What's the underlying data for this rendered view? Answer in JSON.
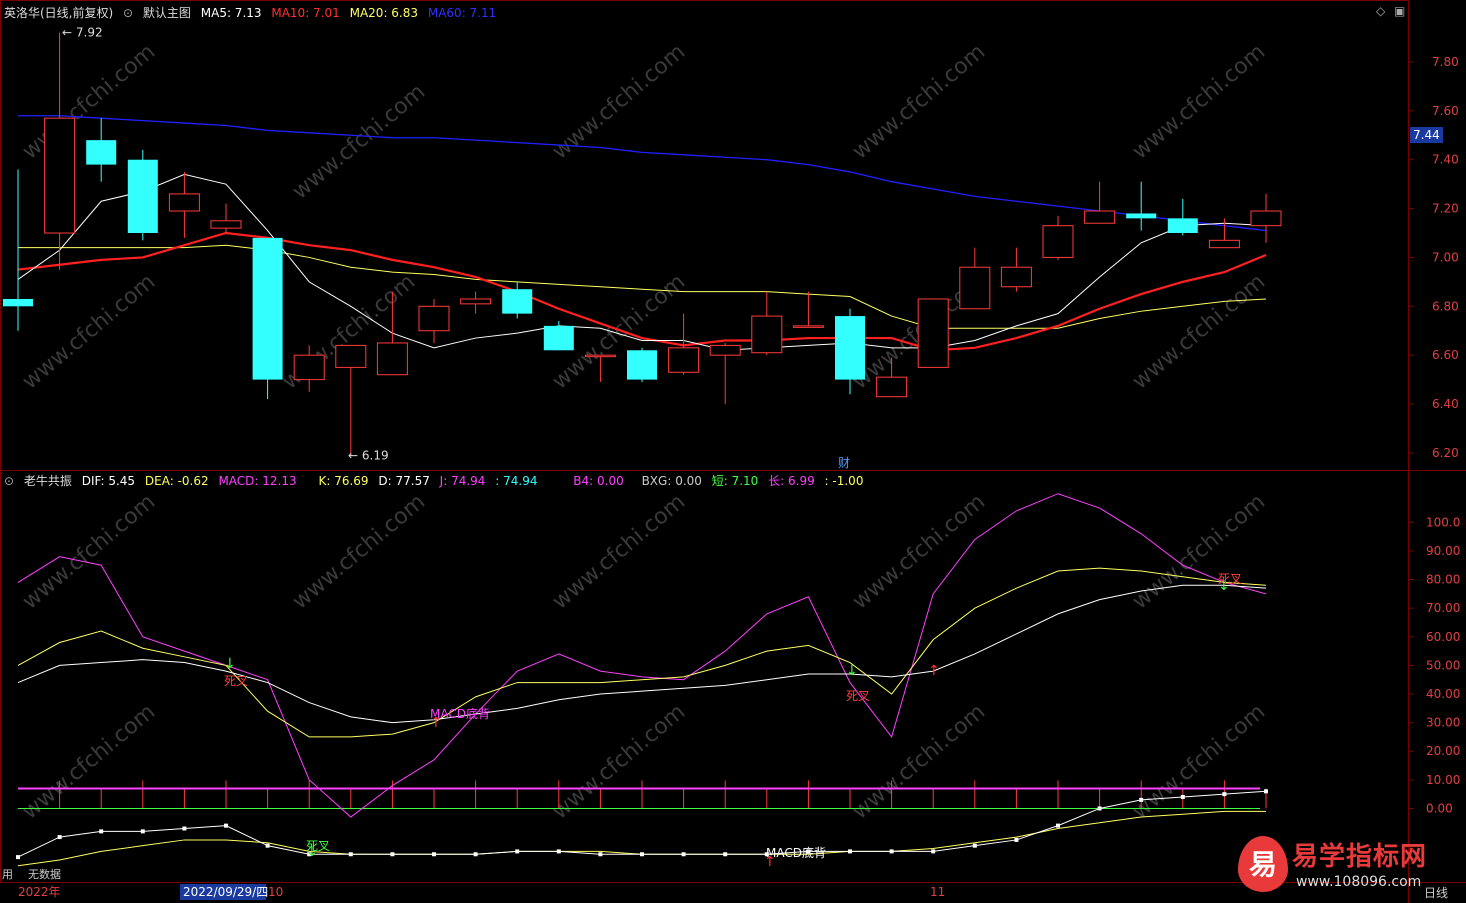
{
  "main_header": {
    "stock": "英洛华(日线,前复权)",
    "template": "默认主图",
    "ma5": "MA5: 7.13",
    "ma10": "MA10: 7.01",
    "ma20": "MA20: 6.83",
    "ma60": "MA60: 7.11"
  },
  "sub_header": {
    "name": "老牛共振",
    "dif": "DIF: 5.45",
    "dea": "DEA: -0.62",
    "macd": "MACD: 12.13",
    "k": "K: 76.69",
    "d": "D: 77.57",
    "j": "J: 74.94",
    "j2": ": 74.94",
    "b4": "B4: 0.00",
    "bxg": "BXG: 0.00",
    "short": "短: 7.10",
    "long": "长: 6.99",
    "extra": ": -1.00"
  },
  "price_tag": "7.44",
  "hi_label": "7.92",
  "lo_label": "6.19",
  "cai": "财",
  "main_axis": [
    "7.80",
    "7.60",
    "7.40",
    "7.20",
    "7.00",
    "6.80",
    "6.60",
    "6.40",
    "6.20"
  ],
  "sub_axis": [
    "100.0",
    "90.00",
    "80.00",
    "70.00",
    "60.00",
    "50.00",
    "40.00",
    "30.00",
    "20.00",
    "10.00",
    "0.00"
  ],
  "signals": [
    "死叉",
    "MACD底背",
    "死叉",
    "死叉",
    "死叉",
    "MACD底背"
  ],
  "bottom": {
    "left_text": "用",
    "left_text2": "无数据",
    "year": "2022年",
    "cursor_date": "2022/09/29/四",
    "m10": "10",
    "m11": "11",
    "period": "日线"
  },
  "watermark": "www.cfchi.com",
  "logo": {
    "mark": "易",
    "name": "易学指标网",
    "url": "www.108096.com"
  },
  "colors": {
    "up": "#ff3b3b",
    "down": "#3ff",
    "ma5": "#fff",
    "ma10": "#ff2020",
    "ma20": "#ffff60",
    "ma60": "#2020ff",
    "grid": "#7a0000"
  },
  "chart_data": {
    "type": "candlestick",
    "ylim": [
      6.13,
      7.98
    ],
    "candles": [
      [
        6.83,
        6.7,
        6.8,
        7.36
      ],
      [
        7.1,
        6.95,
        7.57,
        7.92
      ],
      [
        7.48,
        7.31,
        7.38,
        7.57
      ],
      [
        7.4,
        7.07,
        7.1,
        7.44
      ],
      [
        7.19,
        7.08,
        7.26,
        7.35
      ],
      [
        7.12,
        7.1,
        7.15,
        7.22
      ],
      [
        7.08,
        6.42,
        6.5,
        7.08
      ],
      [
        6.5,
        6.45,
        6.6,
        6.64
      ],
      [
        6.55,
        6.19,
        6.64,
        6.64
      ],
      [
        6.52,
        6.52,
        6.65,
        6.86
      ],
      [
        6.7,
        6.65,
        6.8,
        6.83
      ],
      [
        6.81,
        6.77,
        6.83,
        6.86
      ],
      [
        6.87,
        6.75,
        6.77,
        6.9
      ],
      [
        6.72,
        6.62,
        6.62,
        6.74
      ],
      [
        6.6,
        6.49,
        6.6,
        6.6
      ],
      [
        6.62,
        6.49,
        6.5,
        6.63
      ],
      [
        6.53,
        6.52,
        6.63,
        6.77
      ],
      [
        6.6,
        6.4,
        6.64,
        6.65
      ],
      [
        6.61,
        6.6,
        6.76,
        6.86
      ],
      [
        6.72,
        6.72,
        6.72,
        6.86
      ],
      [
        6.76,
        6.44,
        6.5,
        6.79
      ],
      [
        6.43,
        6.43,
        6.51,
        6.59
      ],
      [
        6.55,
        6.55,
        6.83,
        6.83
      ],
      [
        6.79,
        6.79,
        6.96,
        7.04
      ],
      [
        6.88,
        6.86,
        6.96,
        7.04
      ],
      [
        7.0,
        6.99,
        7.13,
        7.17
      ],
      [
        7.14,
        7.14,
        7.19,
        7.31
      ],
      [
        7.18,
        7.11,
        7.16,
        7.31
      ],
      [
        7.16,
        7.09,
        7.1,
        7.24
      ],
      [
        7.04,
        7.04,
        7.07,
        7.16
      ],
      [
        7.13,
        7.06,
        7.19,
        7.26
      ]
    ],
    "ma5": [
      6.91,
      7.03,
      7.23,
      7.27,
      7.34,
      7.3,
      7.11,
      6.9,
      6.8,
      6.69,
      6.63,
      6.67,
      6.69,
      6.72,
      6.71,
      6.66,
      6.66,
      6.62,
      6.63,
      6.64,
      6.65,
      6.63,
      6.63,
      6.66,
      6.72,
      6.77,
      6.92,
      7.06,
      7.13,
      7.14,
      7.13
    ],
    "ma10": [
      6.95,
      6.97,
      6.99,
      7.0,
      7.05,
      7.1,
      7.08,
      7.05,
      7.03,
      6.99,
      6.96,
      6.92,
      6.86,
      6.79,
      6.73,
      6.67,
      6.64,
      6.66,
      6.66,
      6.67,
      6.67,
      6.67,
      6.62,
      6.63,
      6.67,
      6.72,
      6.79,
      6.85,
      6.9,
      6.94,
      7.01
    ],
    "ma20": [
      7.04,
      7.04,
      7.04,
      7.04,
      7.04,
      7.05,
      7.03,
      7.0,
      6.96,
      6.94,
      6.93,
      6.91,
      6.9,
      6.89,
      6.88,
      6.87,
      6.86,
      6.86,
      6.86,
      6.85,
      6.84,
      6.76,
      6.71,
      6.71,
      6.71,
      6.71,
      6.75,
      6.78,
      6.8,
      6.82,
      6.83
    ],
    "ma60": [
      7.58,
      7.58,
      7.57,
      7.56,
      7.55,
      7.54,
      7.52,
      7.51,
      7.5,
      7.49,
      7.49,
      7.48,
      7.47,
      7.46,
      7.45,
      7.43,
      7.42,
      7.41,
      7.4,
      7.38,
      7.35,
      7.31,
      7.28,
      7.25,
      7.23,
      7.21,
      7.19,
      7.17,
      7.15,
      7.13,
      7.11
    ],
    "sub_ylim": [
      -25,
      112
    ],
    "K": [
      44,
      50,
      51,
      52,
      51,
      48,
      44,
      37,
      32,
      30,
      31,
      33,
      35,
      38,
      40,
      41,
      42,
      43,
      45,
      47,
      47,
      46,
      48,
      54,
      61,
      68,
      73,
      76,
      78,
      78,
      77
    ],
    "D": [
      50,
      58,
      62,
      56,
      53,
      50,
      34,
      25,
      25,
      26,
      30,
      39,
      44,
      44,
      44,
      45,
      46,
      50,
      55,
      57,
      51,
      40,
      59,
      70,
      77,
      83,
      84,
      83,
      81,
      79,
      78
    ],
    "J": [
      79,
      88,
      85,
      60,
      55,
      50,
      45,
      10,
      -3,
      8,
      17,
      33,
      48,
      54,
      48,
      46,
      45,
      55,
      68,
      74,
      44,
      25,
      75,
      94,
      104,
      110,
      105,
      96,
      85,
      79,
      75
    ],
    "ml_upper": 7,
    "ml_lower": 0,
    "white_line": [
      -17,
      -10,
      -8,
      -8,
      -7,
      -6,
      -13,
      -16,
      -16,
      -16,
      -16,
      -16,
      -15,
      -15,
      -16,
      -16,
      -16,
      -16,
      -16,
      -15,
      -15,
      -15,
      -15,
      -13,
      -11,
      -6,
      0,
      3,
      4,
      5,
      6
    ],
    "yellow_line": [
      -20,
      -18,
      -15,
      -13,
      -11,
      -11,
      -12,
      -15,
      -16,
      -16,
      -16,
      -16,
      -15,
      -15,
      -15,
      -16,
      -16,
      -16,
      -16,
      -16,
      -15,
      -15,
      -14,
      -12,
      -10,
      -7,
      -5,
      -3,
      -2,
      -1,
      -1
    ]
  }
}
